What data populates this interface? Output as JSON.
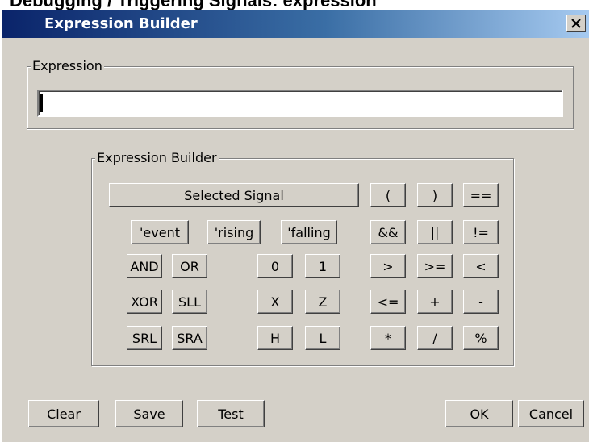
{
  "banner_text": "Debugging / Triggering Signals: expression",
  "window": {
    "title": "Expression Builder"
  },
  "expression_group": {
    "label": "Expression",
    "value": ""
  },
  "builder_group": {
    "label": "Expression Builder"
  },
  "builder": {
    "selected_signal": "Selected Signal",
    "event": "'event",
    "rising": "'rising",
    "falling": "'falling",
    "and": "AND",
    "or": "OR",
    "xor": "XOR",
    "sll": "SLL",
    "srl": "SRL",
    "sra": "SRA",
    "zero": "0",
    "one": "1",
    "x": "X",
    "z": "Z",
    "h": "H",
    "l": "L",
    "lparen": "(",
    "rparen": ")",
    "eq": "==",
    "logand": "&&",
    "logor": "||",
    "neq": "!=",
    "gt": ">",
    "ge": ">=",
    "lt": "<",
    "le": "<=",
    "plus": "+",
    "minus": "-",
    "mul": "*",
    "div": "/",
    "mod": "%"
  },
  "footer": {
    "clear": "Clear",
    "save": "Save",
    "test": "Test",
    "ok": "OK",
    "cancel": "Cancel"
  },
  "icons": {
    "close": "close-icon"
  }
}
